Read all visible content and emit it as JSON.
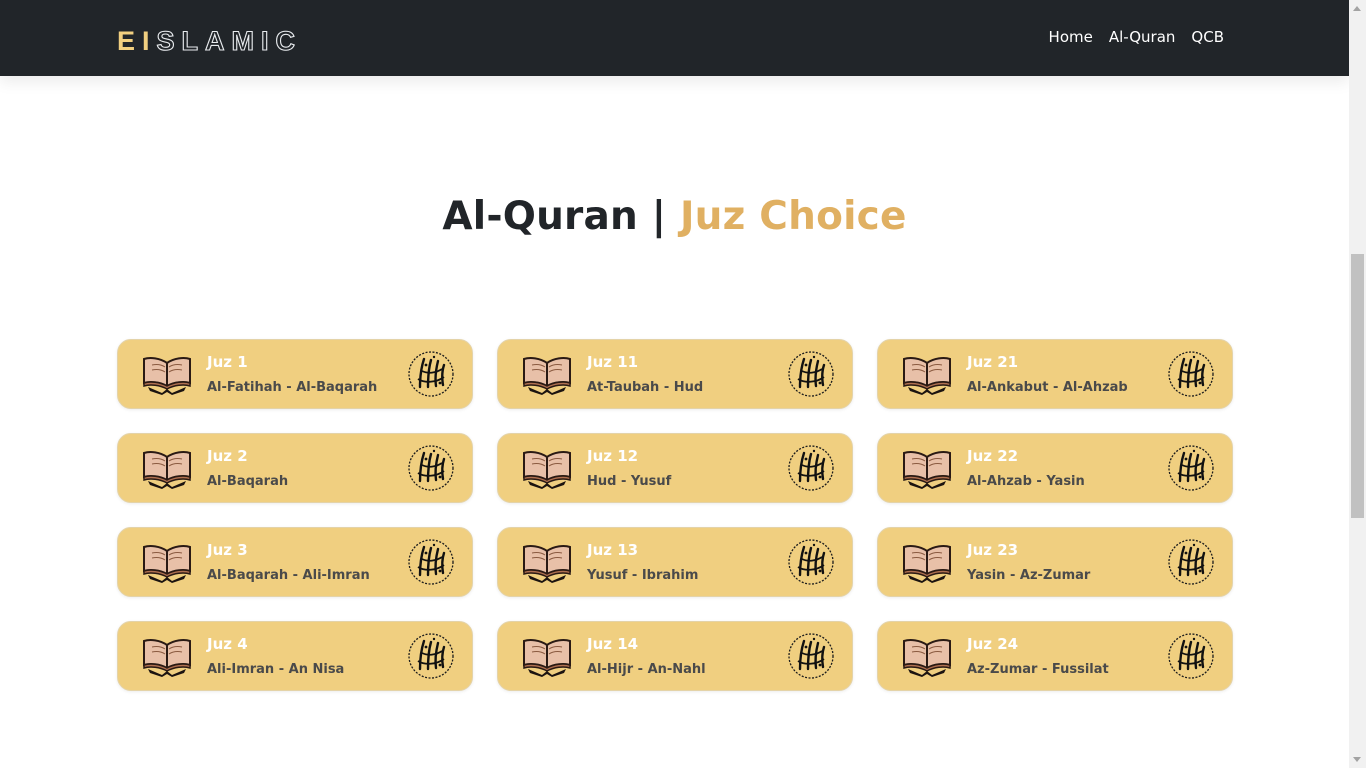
{
  "nav": {
    "brand_ei": "EI",
    "brand_rest": "SLAMIC",
    "links": [
      "Home",
      "Al-Quran",
      "QCB"
    ]
  },
  "heading": {
    "main": "Al-Quran | ",
    "accent": "Juz Choice"
  },
  "juz_cards": [
    {
      "title": "Juz 1",
      "subtitle": "Al-Fatihah - Al-Baqarah"
    },
    {
      "title": "Juz 11",
      "subtitle": "At-Taubah - Hud"
    },
    {
      "title": "Juz 21",
      "subtitle": "Al-Ankabut - Al-Ahzab"
    },
    {
      "title": "Juz 2",
      "subtitle": "Al-Baqarah"
    },
    {
      "title": "Juz 12",
      "subtitle": "Hud - Yusuf"
    },
    {
      "title": "Juz 22",
      "subtitle": "Al-Ahzab - Yasin"
    },
    {
      "title": "Juz 3",
      "subtitle": "Al-Baqarah - Ali-Imran"
    },
    {
      "title": "Juz 13",
      "subtitle": "Yusuf - Ibrahim"
    },
    {
      "title": "Juz 23",
      "subtitle": "Yasin - Az-Zumar"
    },
    {
      "title": "Juz 4",
      "subtitle": "Ali-Imran - An Nisa"
    },
    {
      "title": "Juz 14",
      "subtitle": "Al-Hijr - An-Nahl"
    },
    {
      "title": "Juz 24",
      "subtitle": "Az-Zumar - Fussilat"
    }
  ],
  "icons": {
    "card_left": "open-quran-book-icon",
    "card_right": "quran-calligraphy-icon"
  },
  "colors": {
    "navbar": "#212529",
    "accent": "#e0b062",
    "card": "#f0cf80",
    "brand": "#f1cf80"
  }
}
